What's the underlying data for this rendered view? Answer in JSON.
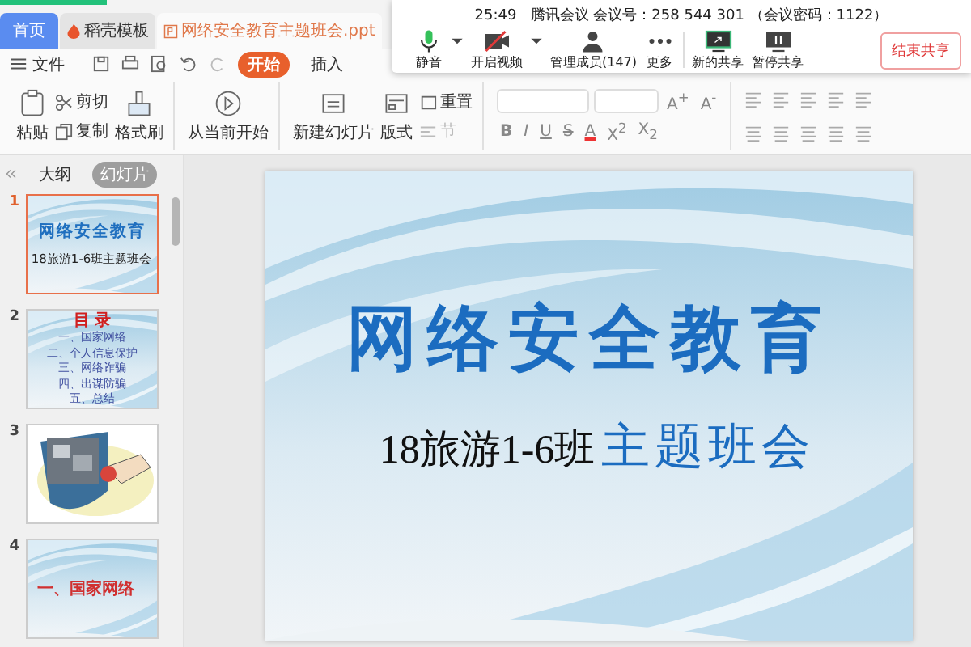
{
  "app_tabs": [
    {
      "label": "首页",
      "kind": "home",
      "selected": false
    },
    {
      "label": "稻壳模板",
      "kind": "docer",
      "selected": false
    },
    {
      "label": "网络安全教育主题班会.ppt",
      "kind": "file",
      "selected": true
    }
  ],
  "menu": {
    "file": "文件",
    "tabs": [
      {
        "label": "开始",
        "selected": true
      },
      {
        "label": "插入",
        "selected": false
      }
    ]
  },
  "ribbon": {
    "paste": "粘贴",
    "cut": "剪切",
    "copy": "复制",
    "format_painter": "格式刷",
    "play": "从当前开始",
    "new_slide": "新建幻灯片",
    "layout": "版式",
    "reset": "重置",
    "section": "节",
    "size_buttons": [
      "A$^{+}$",
      "A$^{-}$"
    ],
    "format_buttons": [
      {
        "label": "B",
        "kind": "bold"
      },
      {
        "label": "I",
        "kind": "italic"
      },
      {
        "label": "U",
        "kind": "underline"
      },
      {
        "label": "S",
        "kind": "strike"
      },
      {
        "label": "A",
        "kind": "color"
      },
      {
        "label": "X$^{2}$",
        "kind": "plain"
      },
      {
        "label": "X$_{2}$",
        "kind": "plain"
      }
    ]
  },
  "meeting": {
    "time": "25:49",
    "info": "腾讯会议 会议号：258 544 301 （会议密码：1122）",
    "buttons": [
      {
        "label": "静音",
        "kind": "mic"
      },
      {
        "label": "开启视频",
        "kind": "camera"
      },
      {
        "label": "管理成员(147)",
        "kind": "members"
      },
      {
        "label": "更多",
        "kind": "more"
      },
      {
        "label": "新的共享",
        "kind": "share"
      },
      {
        "label": "暂停共享",
        "kind": "pause"
      }
    ],
    "end_button": "结束共享"
  },
  "panel": {
    "tabs": [
      {
        "label": "大纲",
        "selected": false
      },
      {
        "label": "幻灯片",
        "selected": true
      }
    ],
    "slides": [
      {
        "number": "1",
        "selected": true,
        "kind": "title",
        "title": "网络安全教育",
        "subtitle": "18旅游1-6班主题班会"
      },
      {
        "number": "2",
        "selected": false,
        "kind": "contents",
        "title": "目 录",
        "items": [
          "一、国家网络",
          "二、个人信息保护",
          "三、网络诈骗",
          "四、出谋防骗",
          "五、总结"
        ]
      },
      {
        "number": "3",
        "selected": false,
        "kind": "picture"
      },
      {
        "number": "4",
        "selected": false,
        "kind": "section",
        "title": "一、国家网络"
      }
    ]
  },
  "slide": {
    "title": "网络安全教育",
    "subtitle_plain": "18旅游1-6班",
    "subtitle_accent": "主题班会"
  }
}
